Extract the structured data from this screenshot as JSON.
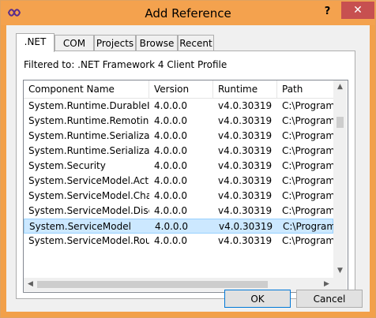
{
  "window": {
    "title": "Add Reference",
    "help": "?",
    "close": "✕"
  },
  "tabs": [
    ".NET",
    "COM",
    "Projects",
    "Browse",
    "Recent"
  ],
  "filter_text": "Filtered to: .NET Framework 4 Client Profile",
  "columns": [
    "Component Name",
    "Version",
    "Runtime",
    "Path"
  ],
  "rows": [
    [
      "System.Runtime.DurableIn...",
      "4.0.0.0",
      "v4.0.30319",
      "C:\\Program"
    ],
    [
      "System.Runtime.Remoting",
      "4.0.0.0",
      "v4.0.30319",
      "C:\\Program"
    ],
    [
      "System.Runtime.Serializati...",
      "4.0.0.0",
      "v4.0.30319",
      "C:\\Program"
    ],
    [
      "System.Runtime.Serializati...",
      "4.0.0.0",
      "v4.0.30319",
      "C:\\Program"
    ],
    [
      "System.Security",
      "4.0.0.0",
      "v4.0.30319",
      "C:\\Program"
    ],
    [
      "System.ServiceModel.Acti...",
      "4.0.0.0",
      "v4.0.30319",
      "C:\\Program"
    ],
    [
      "System.ServiceModel.Cha...",
      "4.0.0.0",
      "v4.0.30319",
      "C:\\Program"
    ],
    [
      "System.ServiceModel.Disc...",
      "4.0.0.0",
      "v4.0.30319",
      "C:\\Program"
    ],
    [
      "System.ServiceModel",
      "4.0.0.0",
      "v4.0.30319",
      "C:\\Program"
    ],
    [
      "System.ServiceModel.Rout...",
      "4.0.0.0",
      "v4.0.30319",
      "C:\\Program"
    ]
  ],
  "selected_row": 8,
  "buttons": {
    "ok": "OK",
    "cancel": "Cancel"
  },
  "colors": {
    "titlebar": "#f4a24e",
    "selection": "#cce8ff",
    "close": "#c75050"
  }
}
